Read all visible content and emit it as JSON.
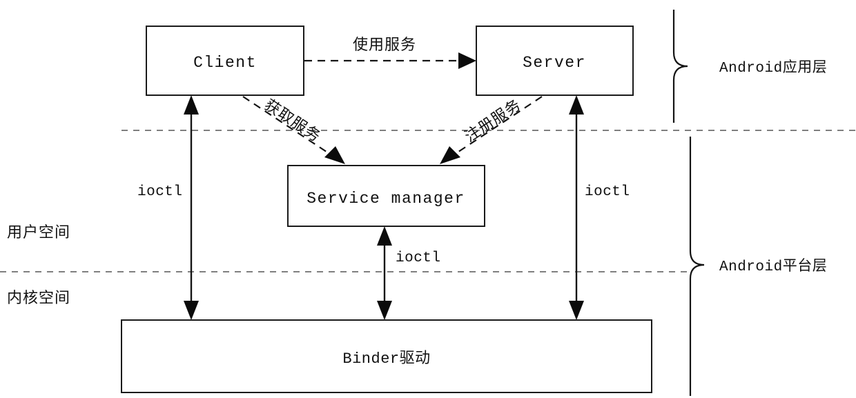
{
  "diagram": {
    "title": "Android Binder IPC architecture diagram",
    "nodes": {
      "client": "Client",
      "server": "Server",
      "service_manager": "Service manager",
      "binder_driver": "Binder驱动"
    },
    "edges": {
      "use_service": "使用服务",
      "get_service": "获取服务",
      "register_service": "注册服务",
      "ioctl_client": "ioctl",
      "ioctl_server": "ioctl",
      "ioctl_service_manager": "ioctl"
    },
    "space_labels": {
      "user_space": "用户空间",
      "kernel_space": "内核空间"
    },
    "layer_labels": {
      "app_layer": "Android应用层",
      "platform_layer": "Android平台层"
    },
    "colors": {
      "stroke": "#141414",
      "divider": "#6d6d6d",
      "box_fill": "#ffffff",
      "background": "#ffffff"
    }
  }
}
